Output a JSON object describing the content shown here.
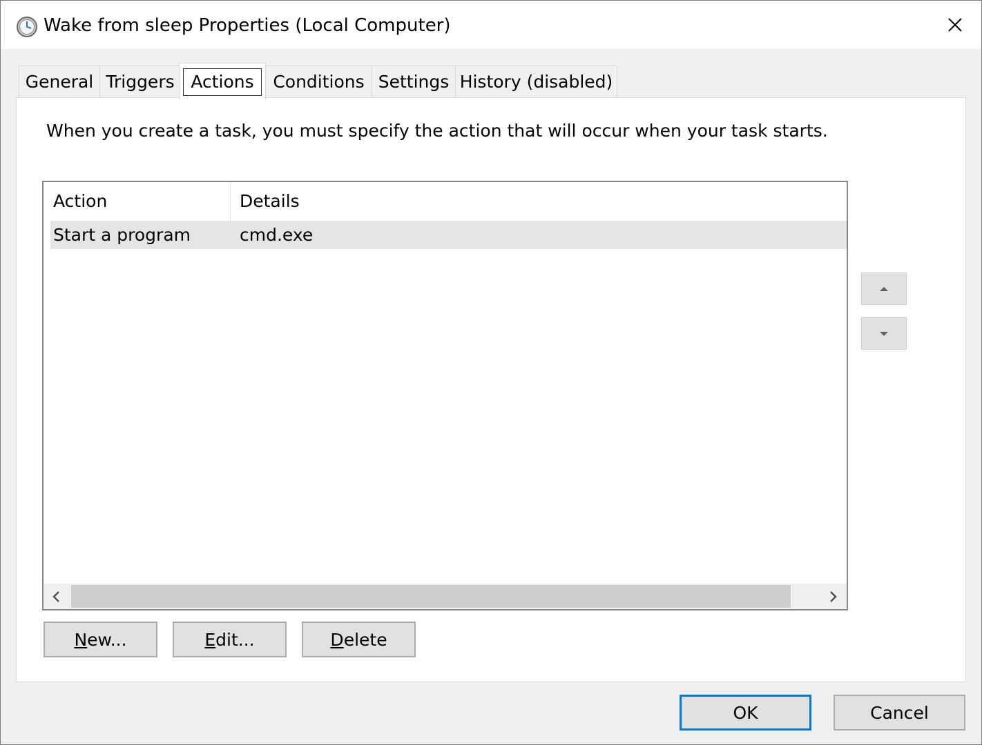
{
  "window": {
    "title": "Wake from sleep Properties (Local Computer)"
  },
  "tabs": [
    {
      "label": "General",
      "active": false
    },
    {
      "label": "Triggers",
      "active": false
    },
    {
      "label": "Actions",
      "active": true
    },
    {
      "label": "Conditions",
      "active": false
    },
    {
      "label": "Settings",
      "active": false
    },
    {
      "label": "History (disabled)",
      "active": false
    }
  ],
  "actions_tab": {
    "description": "When you create a task, you must specify the action that will occur when your task starts.",
    "columns": [
      "Action",
      "Details"
    ],
    "rows": [
      {
        "action": "Start a program",
        "details": "cmd.exe"
      }
    ],
    "buttons": {
      "new_rest": "ew...",
      "new_key": "N",
      "edit_rest": "dit...",
      "edit_key": "E",
      "delete_rest": "elete",
      "delete_key": "D"
    }
  },
  "footer": {
    "ok": "OK",
    "cancel": "Cancel"
  },
  "icons": {
    "app": "task-scheduler-clock-icon",
    "close": "close-icon",
    "move_up": "triangle-up-icon",
    "move_down": "triangle-down-icon",
    "scroll_left": "chevron-left-icon",
    "scroll_right": "chevron-right-icon"
  },
  "colors": {
    "accent": "#0078d7",
    "selected_row": "#e5e5e5"
  }
}
